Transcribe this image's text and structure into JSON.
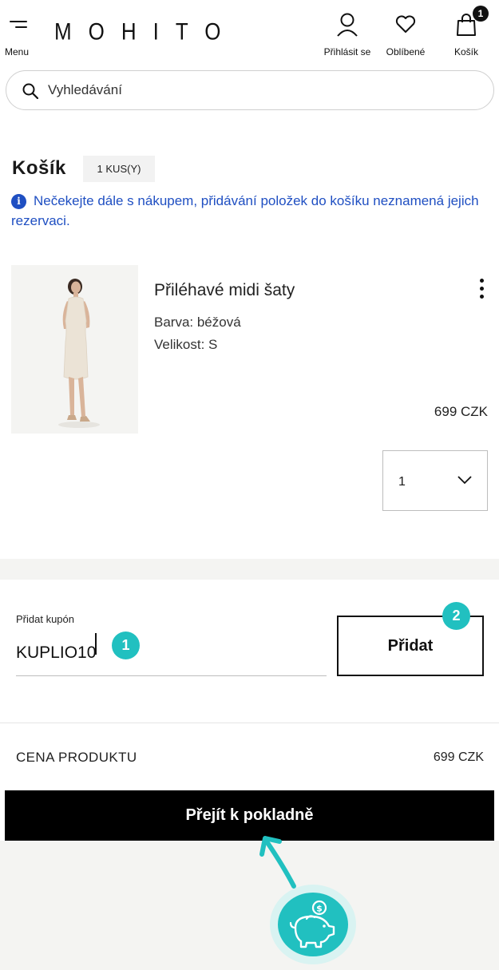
{
  "header": {
    "menu_label": "Menu",
    "logo": "MOHITO",
    "login_label": "Přihlásit se",
    "favorites_label": "Oblíbené",
    "cart_label": "Košík",
    "cart_count": "1"
  },
  "search": {
    "placeholder": "Vyhledávání",
    "icon": "search-icon"
  },
  "cart": {
    "title": "Košík",
    "count_badge": "1 KUS(Y)",
    "info_text": "Nečekejte dále s nákupem, přidávání položek do košíku neznamená jejich rezervaci."
  },
  "product": {
    "name": "Přiléhavé midi šaty",
    "color": "Barva: béžová",
    "size": "Velikost: S",
    "price": "699 CZK",
    "quantity": "1"
  },
  "coupon": {
    "label": "Přidat kupón",
    "value": "KUPLIO10",
    "add_button": "Přidat",
    "step1": "1",
    "step2": "2"
  },
  "summary": {
    "product_price_label": "CENA PRODUKTU",
    "product_price_value": "699 CZK",
    "checkout_button": "Přejít k pokladně"
  },
  "colors": {
    "accent_teal": "#21c0c0",
    "info_blue": "#1f4fc2",
    "checkout_bg": "#000000"
  }
}
